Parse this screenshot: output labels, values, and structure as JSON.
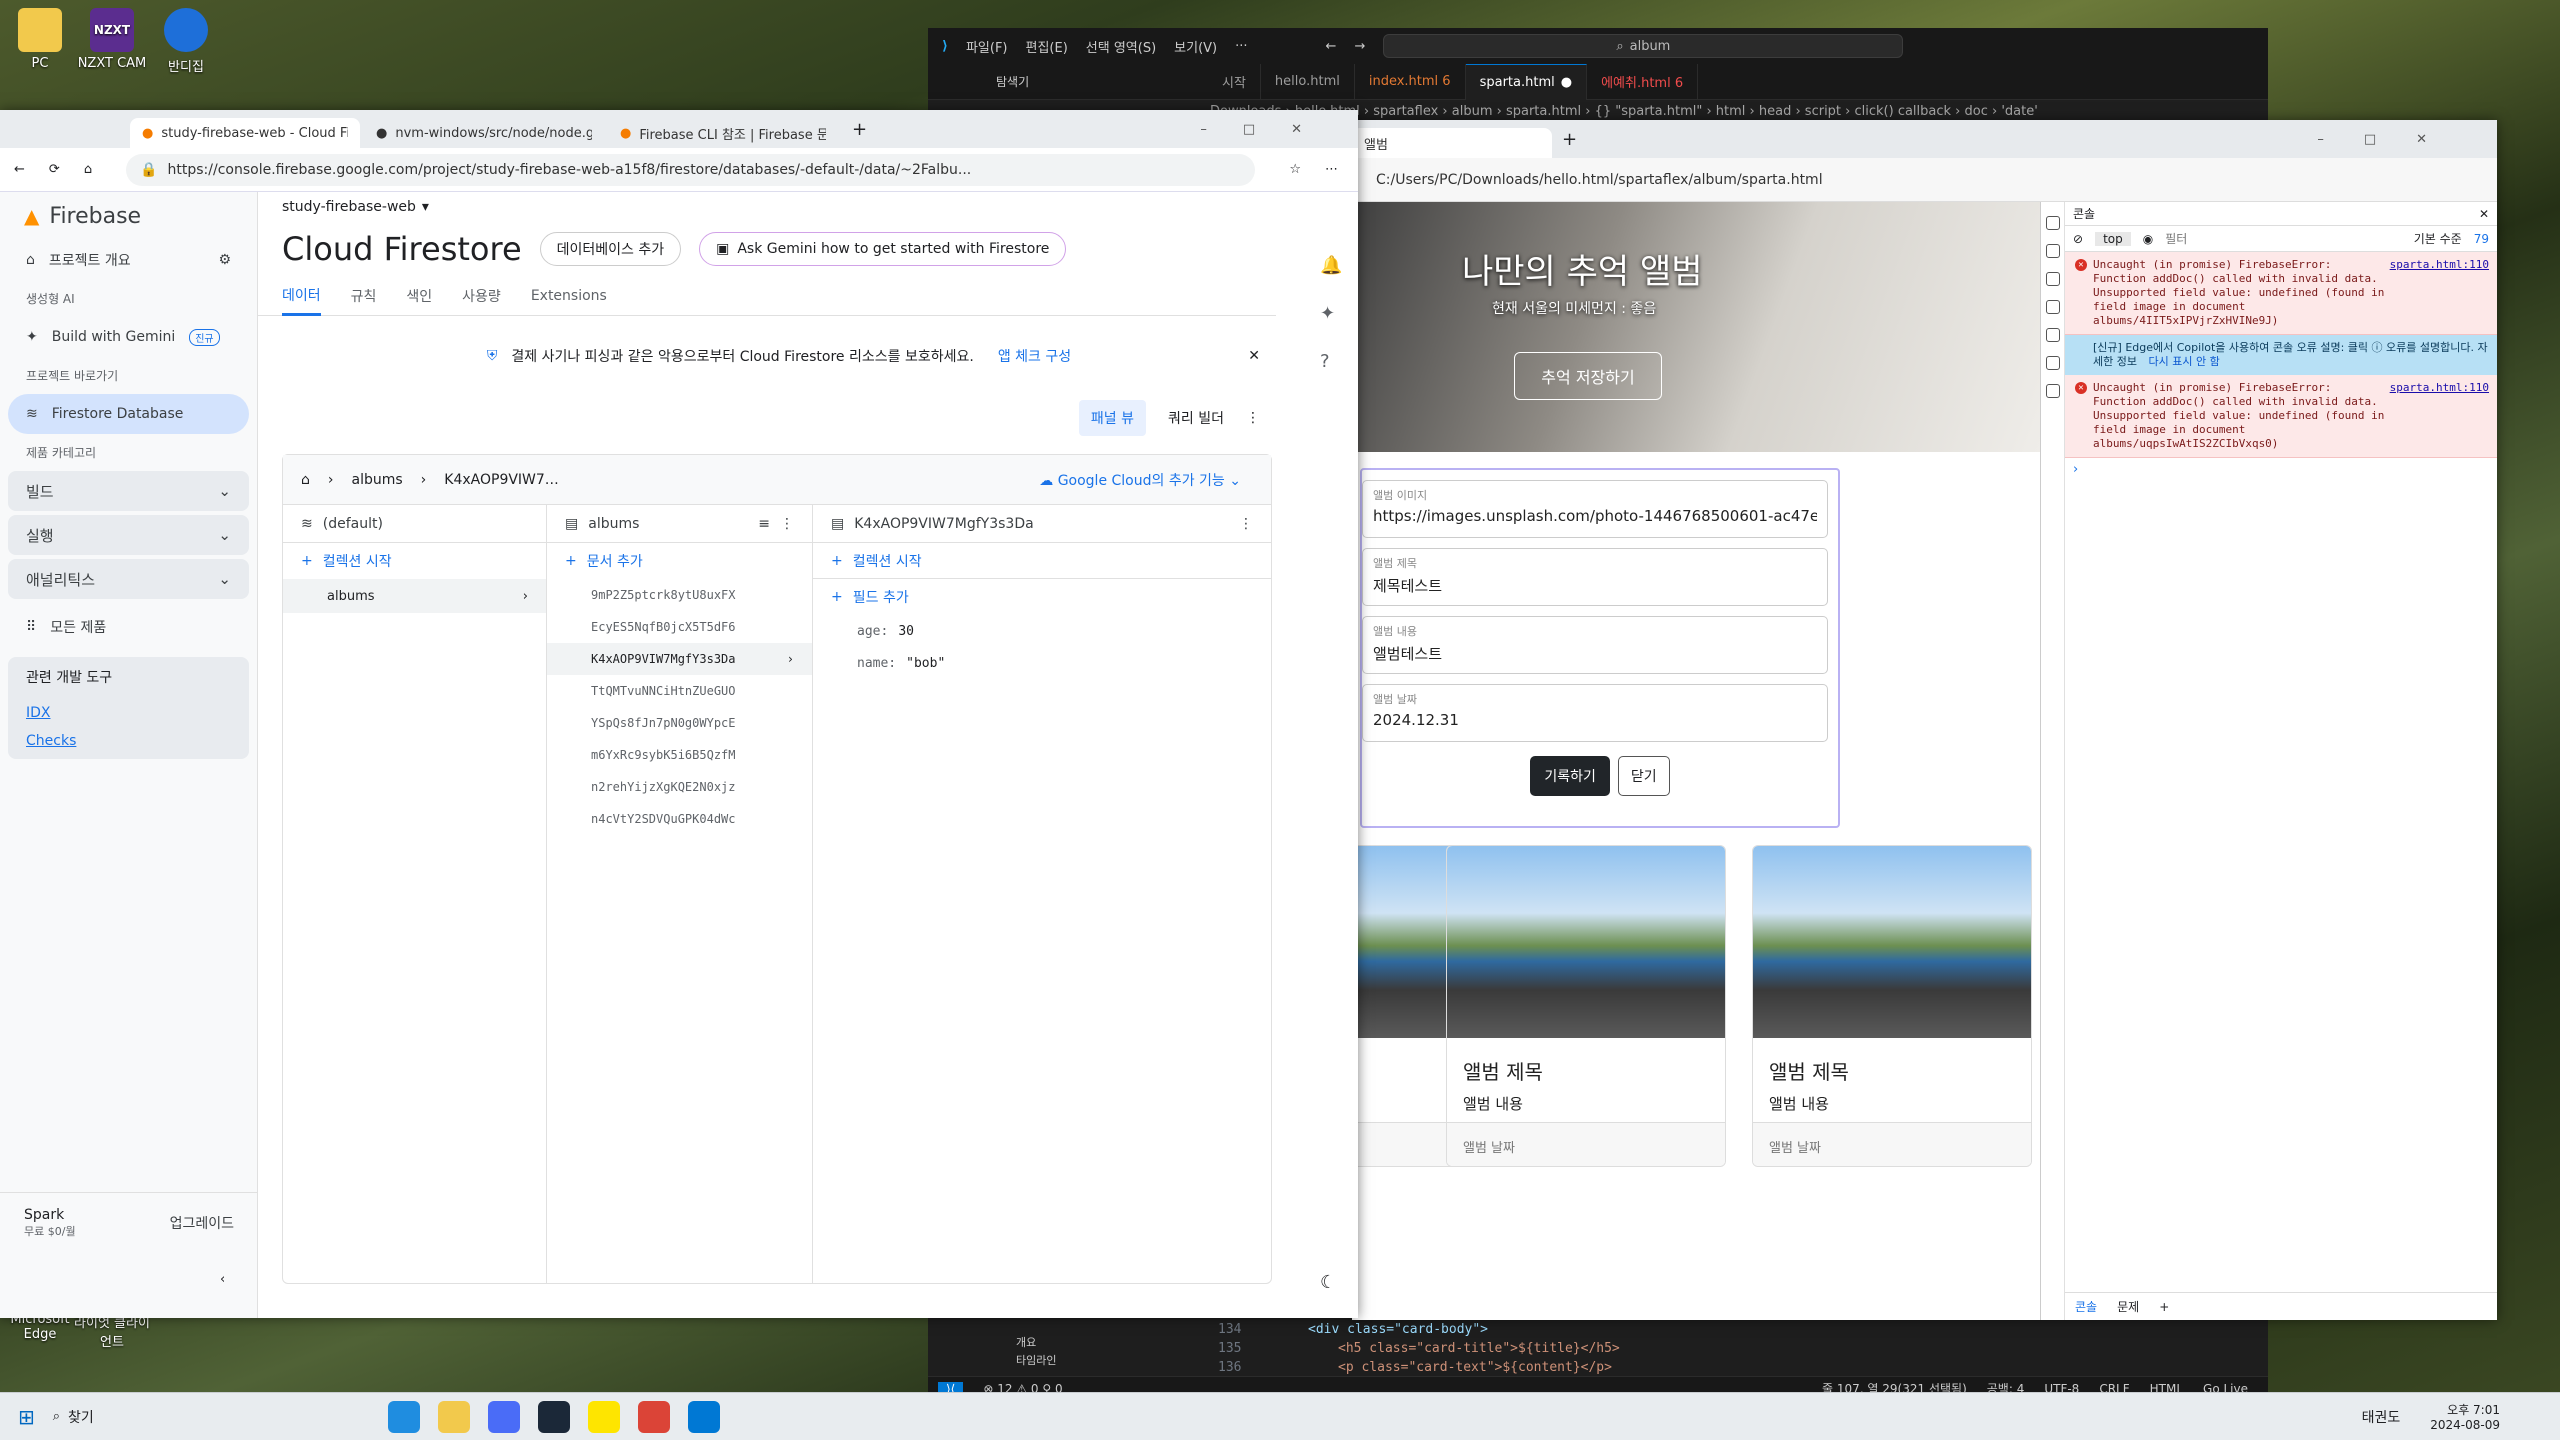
{
  "desktop": {
    "icons": [
      {
        "label": "PC"
      },
      {
        "label": "NZXT CAM"
      },
      {
        "label": "반디집"
      },
      {
        "label": "Microsoft Edge"
      },
      {
        "label": "라이엇 클라이언트"
      }
    ]
  },
  "firebase_window": {
    "tabs": [
      {
        "label": "study-firebase-web - Cloud Fires"
      },
      {
        "label": "nvm-windows/src/node/node.go"
      },
      {
        "label": "Firebase CLI 참조 | Firebase 문서"
      }
    ],
    "url": "https://console.firebase.google.com/project/study-firebase-web-a15f8/firestore/databases/-default-/data/~2Falbu...",
    "brand": "Firebase",
    "sidebar": {
      "project_overview": "프로젝트 개요",
      "gen_ai_section": "생성형 AI",
      "build_with_gemini": "Build with Gemini",
      "new_badge": "진규",
      "shortcuts_section": "프로젝트 바로가기",
      "firestore_database": "Firestore Database",
      "categories_section": "제품 카테고리",
      "groups": [
        "빌드",
        "실행",
        "애널리틱스"
      ],
      "all_products": "모든 제품",
      "dev_tools_title": "관련 개발 도구",
      "idx": "IDX",
      "checks": "Checks",
      "plan_name": "Spark",
      "plan_price": "무료 $0/월",
      "upgrade": "업그레이드"
    },
    "main": {
      "project_select": "study-firebase-web",
      "title": "Cloud Firestore",
      "add_db_button": "데이터베이스 추가",
      "gemini_button": "Ask Gemini how to get started with Firestore",
      "tabs": [
        "데이터",
        "규칙",
        "색인",
        "사용량",
        "Extensions"
      ],
      "banner_text": "결제 사기나 피싱과 같은 악용으로부터 Cloud Firestore 리소스를 보호하세요.",
      "banner_link": "앱 체크 구성",
      "panel_view": "패널 뷰",
      "query_builder": "쿼리 빌더",
      "breadcrumb": [
        "albums",
        "K4xAOP9VIW7…"
      ],
      "gcloud_link": "Google Cloud의 추가 기능",
      "col1": {
        "header": "(default)",
        "add_label": "컬렉션 시작",
        "items": [
          "albums"
        ]
      },
      "col2": {
        "header": "albums",
        "add_label": "문서 추가",
        "items": [
          "9mP2Z5ptcrk8ytU8uxFX",
          "EcyES5NqfB0jcX5T5dF6",
          "K4xAOP9VIW7MgfY3s3Da",
          "TtQMTvuNNCiHtnZUeGUO",
          "YSpQs8fJn7pN0g0WYpcE",
          "m6YxRc9sybK5i6B5QzfM",
          "n2rehYijzXgKQE2N0xjz",
          "n4cVtY2SDVQuGPK04dWc"
        ],
        "selected": "K4xAOP9VIW7MgfY3s3Da"
      },
      "col3": {
        "header": "K4xAOP9VIW7MgfY3s3Da",
        "add_collection": "컬렉션 시작",
        "add_field": "필드 추가",
        "fields": [
          {
            "key": "age:",
            "value": "30"
          },
          {
            "key": "name:",
            "value": "\"bob\""
          }
        ]
      }
    }
  },
  "vscode": {
    "menu": [
      "파일(F)",
      "편집(E)",
      "선택 영역(S)",
      "보기(V)",
      "···"
    ],
    "search": "album",
    "explorer_title": "탐색기",
    "tabs": [
      {
        "label": "시작"
      },
      {
        "label": "hello.html"
      },
      {
        "label": "index.html 6"
      },
      {
        "label": "sparta.html"
      },
      {
        "label": "에예취.html 6"
      }
    ],
    "breadcrumb": "Downloads › hello.html › spartaflex › album › sparta.html › {} \"sparta.html\" › html › head › script › click() callback › doc › 'date'",
    "code_lines": [
      {
        "num": "134",
        "text": "<div class=\"card-body\">"
      },
      {
        "num": "135",
        "text": "<h5 class=\"card-title\">${title}</h5>"
      },
      {
        "num": "136",
        "text": "<p class=\"card-text\">${content}</p>"
      }
    ],
    "outline_items": [
      "개요",
      "타임라인"
    ],
    "status_left": "⊗ 12 ⚠ 0   ⚲ 0",
    "status_right": [
      "줄 107, 열 29(321 선택됨)",
      "공백: 4",
      "UTF-8",
      "CRLF",
      "HTML",
      "Go Live"
    ]
  },
  "edge": {
    "tab_title": "앨범",
    "url": "C:/Users/PC/Downloads/hello.html/spartaflex/album/sparta.html",
    "hero_title": "나만의 추억 앨범",
    "hero_sub": "현재 서울의 미세먼지 : 좋음",
    "hero_button": "추억 저장하기",
    "form": {
      "image_label": "앨범 이미지",
      "image_value": "https://images.unsplash.com/photo-1446768500601-ac47e5ec",
      "title_label": "앨범 제목",
      "title_value": "제목테스트",
      "content_label": "앨범 내용",
      "content_value": "앨범테스트",
      "date_label": "앨범 날짜",
      "date_value": "2024.12.31",
      "save_button": "기록하기",
      "close_button": "닫기"
    },
    "cards": [
      {
        "title": "앨범 제목",
        "content": "앨범 내용",
        "date": "앨범 날짜"
      },
      {
        "title": "앨범 제목",
        "content": "앨범 내용",
        "date": "앨범 날짜"
      }
    ],
    "devtools": {
      "title": "콘솔",
      "context": "top",
      "filter": "필터",
      "level": "기본 수준",
      "issue_count": "79",
      "errors": [
        {
          "text": "Uncaught (in promise) FirebaseError: Function addDoc() called with invalid data. Unsupported field value: undefined (found in field image in document albums/4IIT5xIPVjrZxHVINe9J)",
          "link": "sparta.html:110"
        },
        {
          "text": "Uncaught (in promise) FirebaseError: Function addDoc() called with invalid data. Unsupported field value: undefined (found in field image in document albums/uqpsIwAtIS2ZCIbVxqs0)",
          "link": "sparta.html:110"
        }
      ],
      "info": "[신규] Edge에서 Copilot을 사용하여 콘솔 오류 설명: 클릭 ⓘ 오류를 설명합니다. 자세한 정보",
      "info_dismiss": "다시 표시 안 함",
      "drawer_tabs": [
        "콘솔",
        "문제"
      ]
    }
  },
  "taskbar": {
    "search": "찾기",
    "ime": "태권도",
    "time": "오후 7:01",
    "date": "2024-08-09"
  }
}
